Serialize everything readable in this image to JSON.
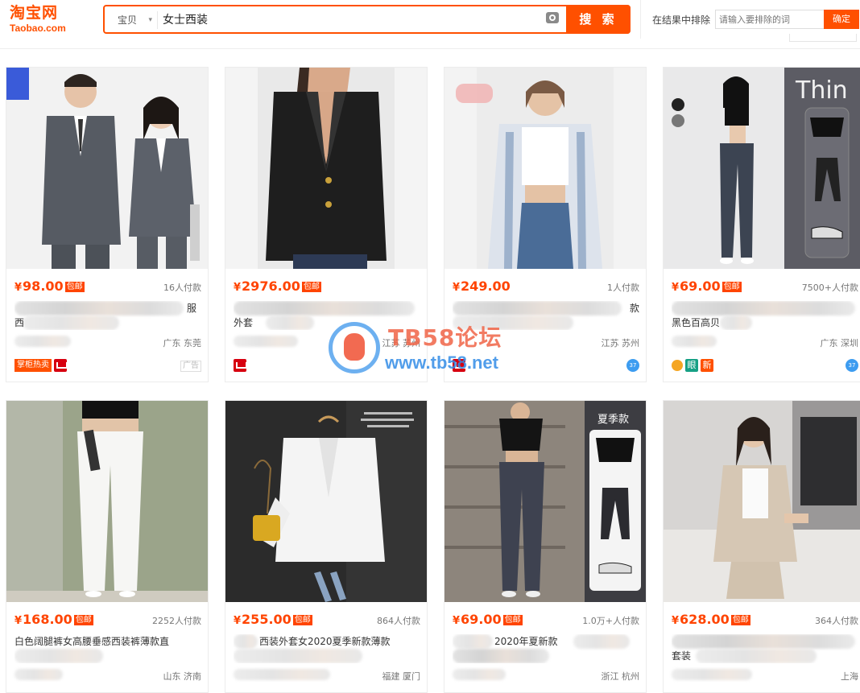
{
  "header": {
    "logo_cn": "淘宝网",
    "logo_en": "Taobao.com",
    "search_type": "宝贝",
    "search_query": "女士西装",
    "search_button": "搜 索",
    "exclude_label": "在结果中排除",
    "exclude_placeholder": "请输入要排除的词",
    "exclude_button": "确定"
  },
  "products": [
    {
      "yen": "¥",
      "price": "98.00",
      "free_ship": "包邮",
      "sold": "16人付款",
      "title_visible": "服",
      "title_visible2": "西",
      "location": "广东 东莞",
      "tag": "掌柜热卖",
      "ad": "广告"
    },
    {
      "yen": "¥",
      "price": "2976.00",
      "free_ship": "包邮",
      "sold": "",
      "title_visible": "外套",
      "title_visible2": "",
      "location": "江苏 苏州",
      "tag": "",
      "ad": ""
    },
    {
      "yen": "¥",
      "price": "249.00",
      "free_ship": "",
      "sold": "1人付款",
      "title_visible": "款",
      "title_visible2": "",
      "location": "江苏 苏州",
      "tag": "",
      "ad": ""
    },
    {
      "yen": "¥",
      "price": "69.00",
      "free_ship": "包邮",
      "sold": "7500+人付款",
      "title_visible": "黑色百高贝",
      "title_visible2": "",
      "location": "广东 深圳",
      "tag": "",
      "ad": "",
      "badges": [
        "眼",
        "新"
      ]
    },
    {
      "yen": "¥",
      "price": "168.00",
      "free_ship": "包邮",
      "sold": "2252人付款",
      "title_visible": "白色阔腿裤女高腰垂感西装裤薄款直",
      "title_visible2": "",
      "location": "山东 济南",
      "tag": "",
      "ad": ""
    },
    {
      "yen": "¥",
      "price": "255.00",
      "free_ship": "包邮",
      "sold": "864人付款",
      "title_visible": "西装外套女2020夏季新款薄款",
      "title_visible2": "",
      "location": "福建 厦门",
      "tag": "",
      "ad": ""
    },
    {
      "yen": "¥",
      "price": "69.00",
      "free_ship": "包邮",
      "sold": "1.0万+人付款",
      "title_visible": "2020年夏新款",
      "title_visible2": "",
      "location": "浙江 杭州",
      "tag": "",
      "ad": ""
    },
    {
      "yen": "¥",
      "price": "628.00",
      "free_ship": "包邮",
      "sold": "364人付款",
      "title_visible": "套装",
      "title_visible2": "",
      "location": "上海",
      "tag": "",
      "ad": ""
    }
  ],
  "watermark": {
    "title": "TB58论坛",
    "url": "www.tb58.net"
  },
  "colors": {
    "brand": "#ff5000",
    "price": "#ff4400"
  }
}
